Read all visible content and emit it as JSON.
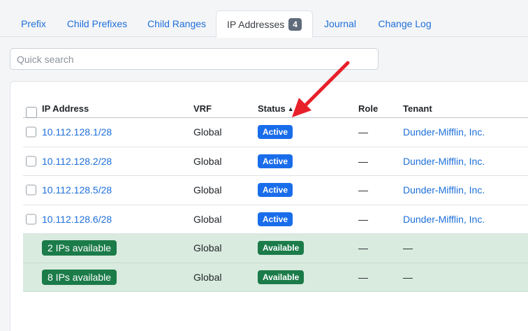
{
  "tabs": [
    {
      "label": "Prefix"
    },
    {
      "label": "Child Prefixes"
    },
    {
      "label": "Child Ranges"
    },
    {
      "label": "IP Addresses",
      "count": "4",
      "active": true
    },
    {
      "label": "Journal"
    },
    {
      "label": "Change Log"
    }
  ],
  "search": {
    "placeholder": "Quick search"
  },
  "table": {
    "headers": {
      "ip": "IP Address",
      "vrf": "VRF",
      "status": "Status",
      "role": "Role",
      "tenant": "Tenant"
    },
    "rows": [
      {
        "ip": "10.112.128.1/28",
        "vrf": "Global",
        "status": "Active",
        "role": "—",
        "tenant": "Dunder-Mifflin, Inc."
      },
      {
        "ip": "10.112.128.2/28",
        "vrf": "Global",
        "status": "Active",
        "role": "—",
        "tenant": "Dunder-Mifflin, Inc."
      },
      {
        "ip": "10.112.128.5/28",
        "vrf": "Global",
        "status": "Active",
        "role": "—",
        "tenant": "Dunder-Mifflin, Inc."
      },
      {
        "ip": "10.112.128.6/28",
        "vrf": "Global",
        "status": "Active",
        "role": "—",
        "tenant": "Dunder-Mifflin, Inc."
      }
    ],
    "available_rows": [
      {
        "label": "2 IPs available",
        "vrf": "Global",
        "status": "Available",
        "role": "—",
        "tenant": "—"
      },
      {
        "label": "8 IPs available",
        "vrf": "Global",
        "status": "Available",
        "role": "—",
        "tenant": "—"
      }
    ]
  },
  "colors": {
    "link": "#1e6fd9",
    "active_badge": "#1a6dea",
    "available_badge": "#1b7b49",
    "available_row": "#d9ebdf",
    "annotation_arrow": "#e8202a"
  }
}
